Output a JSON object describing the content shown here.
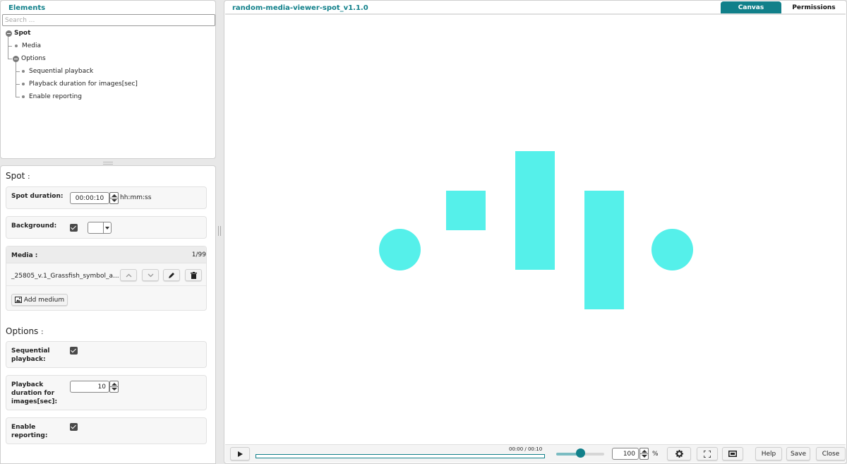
{
  "elements_panel": {
    "title": "Elements",
    "search_placeholder": "Search ...",
    "tree": {
      "spot": "Spot",
      "media": "Media",
      "options": "Options",
      "sequential": "Sequential playback",
      "duration": "Playback duration for images[sec]",
      "reporting": "Enable reporting"
    }
  },
  "spot_section": {
    "title": "Spot",
    "colon": ":",
    "duration_label": "Spot duration:",
    "duration_value": "00:00:10",
    "duration_unit": "hh:mm:ss",
    "background_label": "Background:",
    "background_checked": true
  },
  "media_section": {
    "label": "Media :",
    "count": "1/99",
    "item_name": "_25805_v.1_Grassfish_symbol_a...",
    "add_button": "Add medium"
  },
  "options_section": {
    "title": "Options",
    "colon": ":",
    "sequential_label_1": "Sequential",
    "sequential_label_2": "playback:",
    "sequential_checked": true,
    "duration_label_1": "Playback",
    "duration_label_2": "duration for",
    "duration_label_3": "images[sec]:",
    "duration_value": "10",
    "reporting_label_1": "Enable",
    "reporting_label_2": "reporting:",
    "reporting_checked": true
  },
  "main": {
    "title": "random-media-viewer-spot_v1.1.0",
    "tabs": [
      "Canvas",
      "Permissions"
    ],
    "active_tab": "Canvas",
    "shape_color": "#55f0ea"
  },
  "controls": {
    "time": "00:00 / 00:10",
    "progress": 0,
    "volume": 0.5,
    "zoom": "100",
    "zoom_unit": "%",
    "help": "Help",
    "save": "Save",
    "close": "Close"
  },
  "icons": {
    "play": "play-icon",
    "settings": "gear-icon",
    "fullscreen": "fullscreen-icon",
    "fit": "fit-screen-icon",
    "edit": "pencil-icon",
    "delete": "trash-icon",
    "up": "chevron-up-icon",
    "down": "chevron-down-icon",
    "add_media": "image-icon"
  },
  "colors": {
    "accent": "#11808a"
  }
}
